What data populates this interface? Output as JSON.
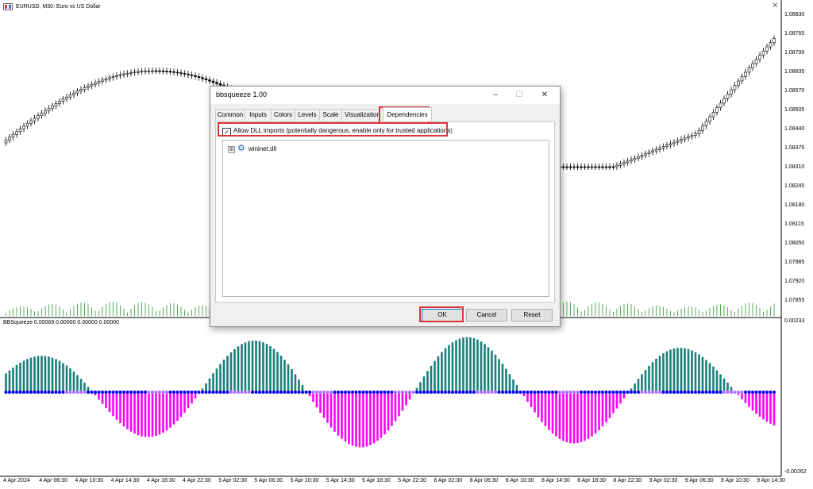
{
  "chart": {
    "symbol_caption": "EURUSD, M30:  Euro vs US Dollar",
    "indicator_caption": "BBSqueeze 0.00069 0.00000 0.00000 0.00000",
    "price_axis": [
      "1.08830",
      "1.08765",
      "1.08700",
      "1.08635",
      "1.08570",
      "1.08505",
      "1.08440",
      "1.08375",
      "1.08310",
      "1.08245",
      "1.08180",
      "1.08115",
      "1.08050",
      "1.07985",
      "1.07920",
      "1.07855"
    ],
    "indicator_axis": [
      "0.00233",
      "-0.00262"
    ],
    "time_axis": [
      "4 Apr 2024",
      "4 Apr 06:30",
      "4 Apr 10:30",
      "4 Apr 14:30",
      "4 Apr 18:30",
      "4 Apr 22:30",
      "5 Apr 02:30",
      "5 Apr 06:30",
      "5 Apr 10:30",
      "5 Apr 14:30",
      "5 Apr 18:30",
      "5 Apr 22:30",
      "8 Apr 02:30",
      "8 Apr 06:30",
      "8 Apr 10:30",
      "8 Apr 14:30",
      "8 Apr 18:30",
      "8 Apr 22:30",
      "9 Apr 02:30",
      "9 Apr 06:30",
      "9 Apr 10:30",
      "9 Apr 14:30"
    ],
    "colors": {
      "bull_bar": "#1a7f7a",
      "bear_bar": "#ff00ff",
      "squeeze_dot": "#0000ff",
      "no_squeeze_dot": "#b070ff",
      "volume": "#2a9a2a"
    }
  },
  "dialog": {
    "title": "bbsqueeze 1.00",
    "window_buttons": {
      "minimize": "–",
      "maximize": "☐",
      "close": "✕"
    },
    "tabs": [
      "Common",
      "Inputs",
      "Colors",
      "Levels",
      "Scale",
      "Visualization",
      "Dependencies"
    ],
    "active_tab": "Dependencies",
    "allow_dll_checked": true,
    "allow_dll_label": "Allow DLL imports (potentially dangerous, enable only for trusted applications)",
    "dependencies": [
      {
        "name": "wininet.dll",
        "expander": "⊞"
      }
    ],
    "buttons": {
      "ok": "OK",
      "cancel": "Cancel",
      "reset": "Reset"
    },
    "highlight_color": "#e0333a"
  }
}
